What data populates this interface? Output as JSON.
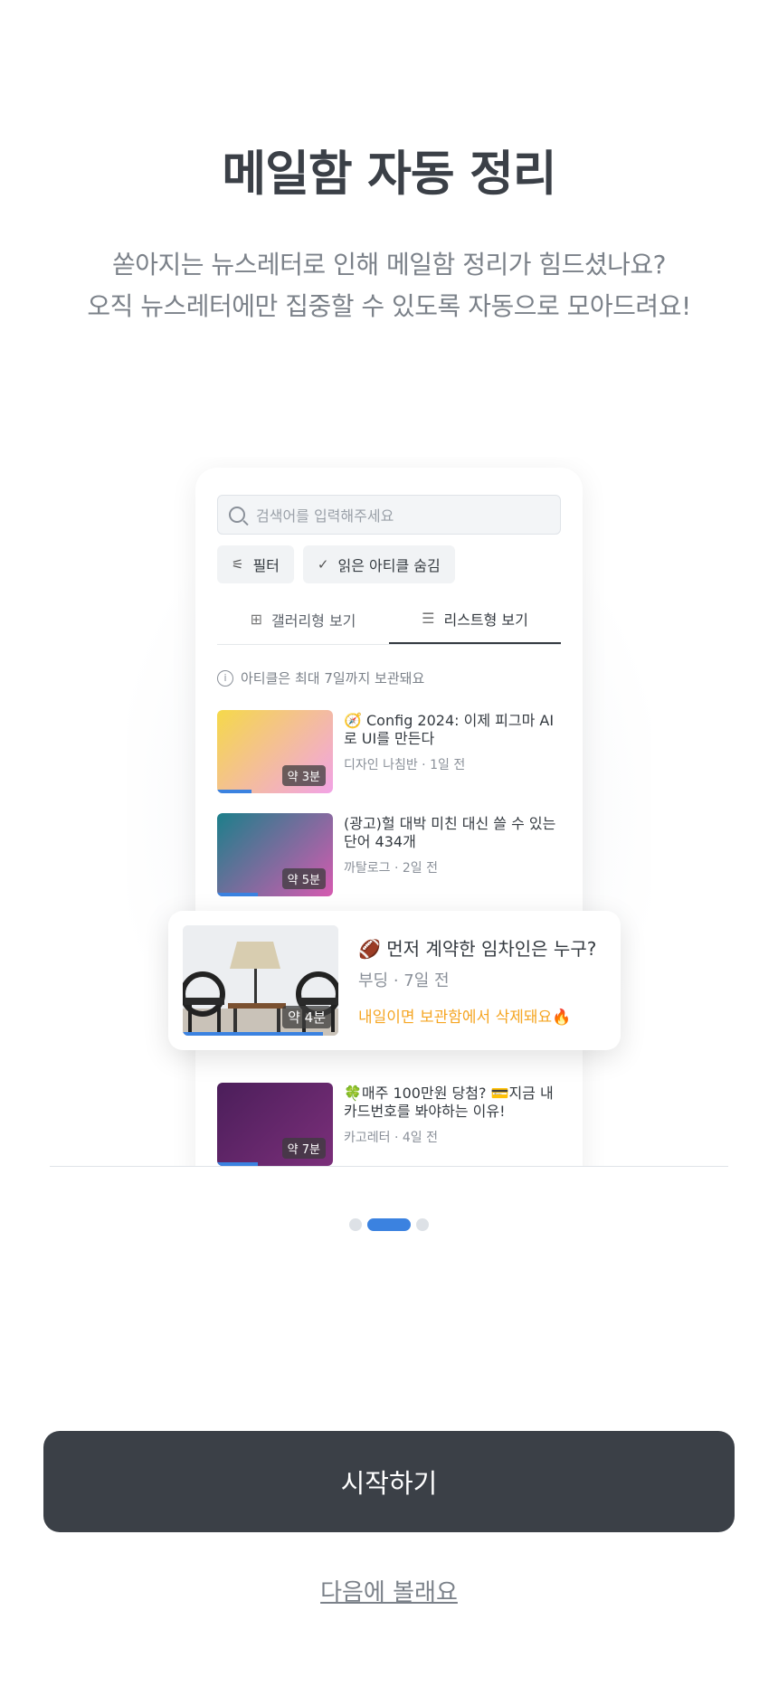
{
  "header": {
    "title": "메일함 자동 정리",
    "subtitle_line1": "쏟아지는 뉴스레터로 인해 메일함 정리가 힘드셨나요?",
    "subtitle_line2": "오직 뉴스레터에만 집중할 수 있도록 자동으로 모아드려요!"
  },
  "preview": {
    "search_placeholder": "검색어를 입력해주세요",
    "filter_label": "필터",
    "hide_read_label": "읽은 아티클 숨김",
    "tabs": [
      {
        "label": "갤러리형 보기",
        "icon": "grid-icon"
      },
      {
        "label": "리스트형 보기",
        "icon": "list-icon"
      }
    ],
    "notice": "아티클은 최대 7일까지 보관돼요",
    "articles": [
      {
        "title": "🧭 Config 2024: 이제 피그마 AI로 UI를 만든다",
        "sub": "디자인 나침반 · 1일 전",
        "read_time": "약 3분",
        "progress": 0.3,
        "colors": [
          "#f5d94a",
          "#f2a3e6"
        ]
      },
      {
        "title": "(광고)헐 대박 미친 대신 쓸 수 있는 단어 434개",
        "sub": "까탈로그 · 2일 전",
        "read_time": "약 5분",
        "progress": 0.35,
        "colors": [
          "#1c7f8a",
          "#d65ab0"
        ]
      },
      {
        "title": "🍀매주 100만원 당첨? 💳지금 내 카드번호를 봐야하는 이유!",
        "sub": "카고레터 · 4일 전",
        "read_time": "약 7분",
        "progress": 0.35,
        "colors": [
          "#4b1e5a",
          "#7b2f7a"
        ]
      }
    ],
    "highlight": {
      "title": "🏈 먼저 계약한 임차인은 누구?",
      "sub": "부딩 · 7일 전",
      "warning": "내일이면 보관함에서 삭제돼요🔥",
      "read_time": "약 4분",
      "progress": 0.9
    }
  },
  "pagination": {
    "pages": 3,
    "active": 2
  },
  "actions": {
    "start_label": "시작하기",
    "later_label": "다음에 볼래요"
  }
}
